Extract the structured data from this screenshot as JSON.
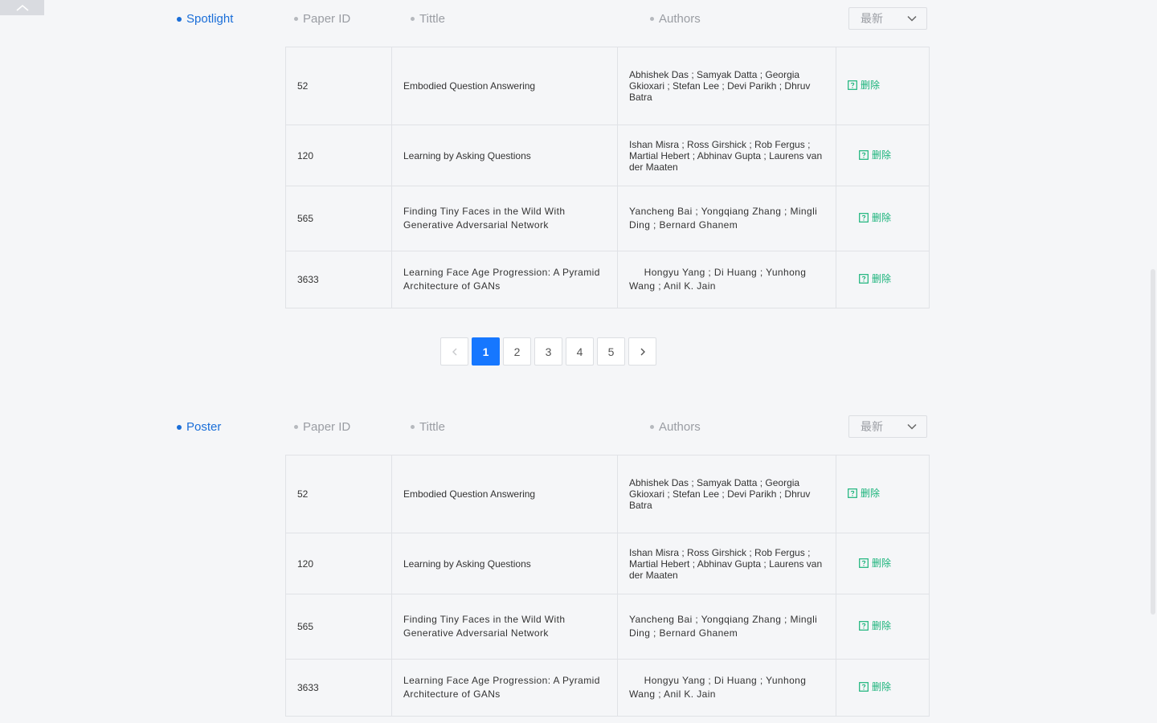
{
  "columns": {
    "paper_id": "Paper ID",
    "title": "Tittle",
    "authors": "Authors"
  },
  "sort_select": {
    "value": "最新"
  },
  "delete_label": "删除",
  "rows": [
    {
      "id": "52",
      "title": "Embodied Question Answering",
      "authors": "Abhishek Das ; Samyak Datta ; Georgia Gkioxari ; Stefan Lee ; Devi Parikh ; Dhruv Batra"
    },
    {
      "id": "120",
      "title": "Learning by Asking Questions",
      "authors": "Ishan Misra ; Ross Girshick ; Rob Fergus ; Martial Hebert ; Abhinav Gupta ; Laurens van der Maaten"
    },
    {
      "id": "565",
      "title": " Finding Tiny Faces in the Wild With Generative Adversarial Network",
      "authors": " Yancheng Bai ; Yongqiang Zhang ; Mingli Ding ; Bernard Ghanem"
    },
    {
      "id": "3633",
      "title": "Learning Face Age Progression: A Pyramid Architecture of GANs",
      "authors": "     Hongyu Yang ; Di Huang ; Yunhong Wang ; Anil K. Jain"
    }
  ],
  "sections": {
    "spotlight": {
      "label": "Spotlight"
    },
    "poster": {
      "label": "Poster"
    }
  },
  "pagination": {
    "pages": [
      "1",
      "2",
      "3",
      "4",
      "5"
    ],
    "current": "1"
  },
  "icons": {
    "collapse": "chevron-up-icon",
    "select_arrow": "chevron-down-icon",
    "delete": "help-square-icon",
    "prev": "chevron-left-icon",
    "next": "chevron-right-icon"
  },
  "colors": {
    "accent_blue": "#1a6ed8",
    "active_page": "#1677ff",
    "delete_green": "#19b37a",
    "muted": "#9a9da3"
  }
}
